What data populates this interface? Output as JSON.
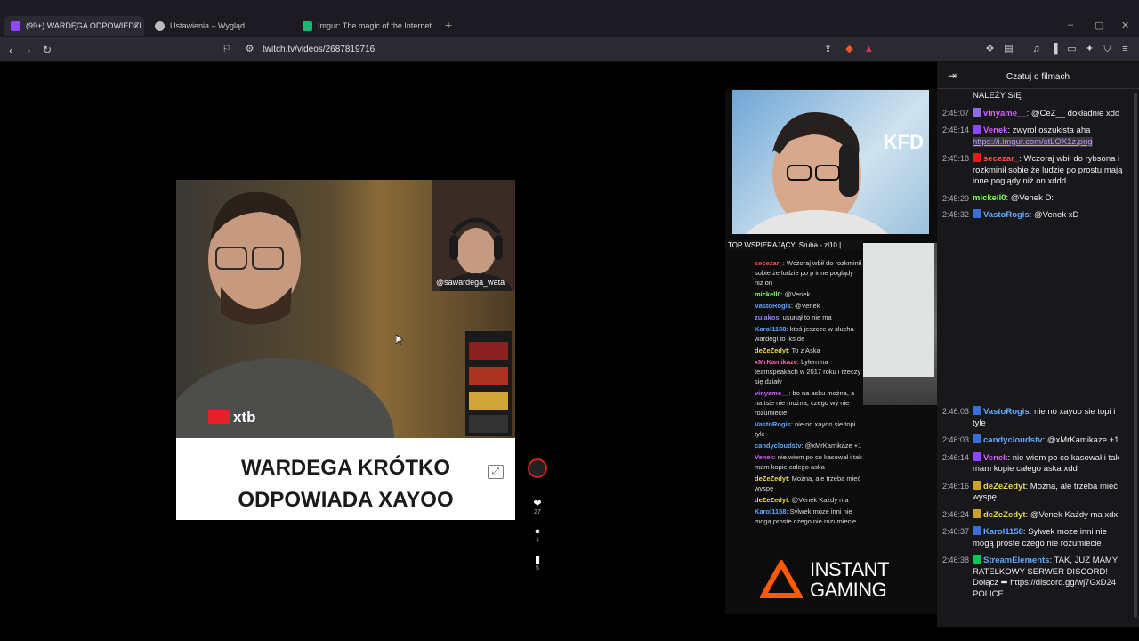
{
  "browser": {
    "tabs": [
      {
        "label": "(99+) WARDĘGA ODPOWIEDZI",
        "favicon_color": "#9147ff",
        "active": true
      },
      {
        "label": "Ustawienia – Wygląd",
        "favicon_color": "#cccccc",
        "active": false
      },
      {
        "label": "Imgur: The magic of the Internet",
        "favicon_color": "#1bb76e",
        "active": false
      }
    ],
    "new_tab": "+",
    "close_tab": "×",
    "url": "twitch.tv/videos/2687819716"
  },
  "video": {
    "overlay_handle": "@sawardega_wata",
    "sponsor": "xtb",
    "caption_line1": "WARDEGA KRÓTKO",
    "caption_line2": "ODPOWIADA XAYOO",
    "actions": [
      {
        "icon": "heart-icon",
        "count": "27"
      },
      {
        "icon": "comment-icon",
        "count": "1"
      },
      {
        "icon": "bookmark-icon",
        "count": "5"
      }
    ]
  },
  "stream": {
    "logo": "KFD",
    "top_supporter": "TOP WSPIERAJĄCY: Sruba - zł10 |",
    "mini_chat": [
      {
        "user": "secezar_",
        "color": "#ff4f4f",
        "text": "Wczoraj wbił do rozkminił sobie że ludzie po p inne poglądy niż on"
      },
      {
        "user": "mickell0",
        "color": "#7cff5a",
        "text": "@Venek"
      },
      {
        "user": "VastoRogis",
        "color": "#5fa8ff",
        "text": "@Venek"
      },
      {
        "user": "zulakos",
        "color": "#8a8aff",
        "text": "usunął to nie ma"
      },
      {
        "user": "Karol1158",
        "color": "#5fa8ff",
        "text": "ktoś jeszcze w słucha wardegi to iks de"
      },
      {
        "user": "deZeZedyt",
        "color": "#e8d94a",
        "text": "To z Aska"
      },
      {
        "user": "xMrKamikaze",
        "color": "#ff5fb0",
        "text": "byłem na teamspeakach w 2017 roku i rzeczy się działy"
      },
      {
        "user": "vinyame__",
        "color": "#d65fff",
        "text": "bo na asku można, a na tsie nie można, czego wy nie rozumiecie"
      },
      {
        "user": "VastoRogis",
        "color": "#5fa8ff",
        "text": "nie no xayoo sie topi tyle"
      },
      {
        "user": "candycloudstv",
        "color": "#5fa8ff",
        "text": "@xMrKamikaze +1"
      },
      {
        "user": "Venek",
        "color": "#d65fff",
        "text": "nie wiem po co kasował i tak mam kopie całego aska"
      },
      {
        "user": "deZeZedyt",
        "color": "#e8d94a",
        "text": "Można, ale trzeba mieć wyspę"
      },
      {
        "user": "deZeZedyt",
        "color": "#e8d94a",
        "text": "@Venek Każdy ma"
      },
      {
        "user": "Karol1158",
        "color": "#5fa8ff",
        "text": "Sylwek moze inni nie mogą proste czego nie rozumiecie"
      }
    ],
    "sponsor_banner": "INSTANT GAMING"
  },
  "chat": {
    "title": "Czatuj o filmach",
    "top_messages": [
      {
        "ts": "",
        "user": "",
        "color": "#adadb8",
        "badge": "",
        "text": "NALEŻY SIĘ"
      },
      {
        "ts": "2:45:07",
        "user": "vinyame__",
        "color": "#d65fff",
        "badge": "#8f6be8",
        "text": "@CeZ__ dokładnie xdd"
      },
      {
        "ts": "2:45:14",
        "user": "Venek",
        "color": "#d65fff",
        "badge": "#9147ff",
        "text": "zwyrol oszukista aha",
        "link": "https://i.imgur.com/stLOX1z.png"
      },
      {
        "ts": "2:45:18",
        "user": "secezar_",
        "color": "#ff4f4f",
        "badge": "#e91916",
        "text": "Wczoraj wbił do rybsona i rozkminił sobie że ludzie po prostu mają inne poglądy niż on xddd"
      },
      {
        "ts": "2:45:29",
        "user": "mickell0",
        "color": "#7cff5a",
        "badge": "",
        "text": "@Venek D:"
      },
      {
        "ts": "2:45:32",
        "user": "VastoRogis",
        "color": "#5fa8ff",
        "badge": "#3a6fd8",
        "text": "@Venek xD"
      }
    ],
    "bottom_messages": [
      {
        "ts": "2:46:03",
        "user": "VastoRogis",
        "color": "#5fa8ff",
        "badge": "#3a6fd8",
        "text": "nie no xayoo sie topi i tyle"
      },
      {
        "ts": "2:46:03",
        "user": "candycloudstv",
        "color": "#5fa8ff",
        "badge": "#3a6fd8",
        "text": "@xMrKamikaze +1"
      },
      {
        "ts": "2:46:14",
        "user": "Venek",
        "color": "#d65fff",
        "badge": "#9147ff",
        "text": "nie wiem po co kasował i tak mam kopie całego aska xdd"
      },
      {
        "ts": "2:46:16",
        "user": "deZeZedyt",
        "color": "#e8d94a",
        "badge": "#c9a227",
        "text": "Można, ale trzeba mieć wyspę"
      },
      {
        "ts": "2:46:24",
        "user": "deZeZedyt",
        "color": "#e8d94a",
        "badge": "#c9a227",
        "text": "@Venek Każdy ma xdx"
      },
      {
        "ts": "2:46:37",
        "user": "Karol1158",
        "color": "#5fa8ff",
        "badge": "#3a6fd8",
        "text": "Sylwek moze inni nie mogą proste czego nie rozumiecie"
      },
      {
        "ts": "2:46:38",
        "user": "StreamElements",
        "color": "#5fa8ff",
        "badge": "#00c853",
        "text": "TAK, JUŻ MAMY RATELKOWY SERWER DISCORD! Dołącz ➡ https://discord.gg/wj7GxD24 POLICE"
      }
    ]
  }
}
